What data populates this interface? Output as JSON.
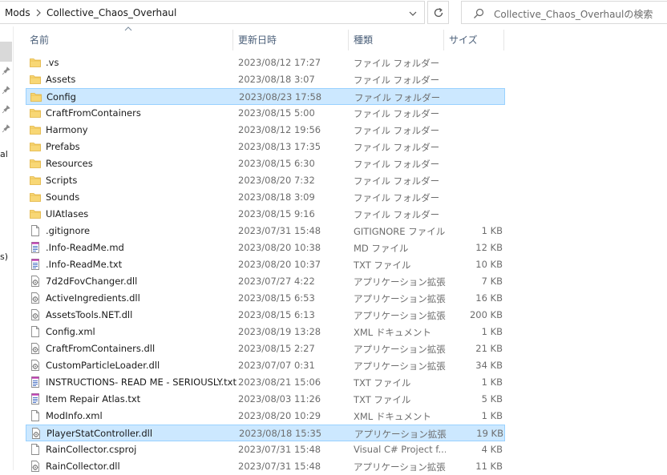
{
  "address": {
    "crumbs": [
      "Mods",
      "Collective_Chaos_Overhaul"
    ]
  },
  "search": {
    "placeholder": "Collective_Chaos_Overhaulの検索"
  },
  "nav": {
    "partial_labels": [
      "al",
      "s)"
    ]
  },
  "columns": {
    "name": "名前",
    "date": "更新日時",
    "type": "種類",
    "size": "サイズ"
  },
  "files": [
    {
      "name": ".vs",
      "date": "2023/08/12 17:27",
      "type": "ファイル フォルダー",
      "size": "",
      "icon": "folder-icon"
    },
    {
      "name": "Assets",
      "date": "2023/08/18 3:07",
      "type": "ファイル フォルダー",
      "size": "",
      "icon": "folder-icon"
    },
    {
      "name": "Config",
      "date": "2023/08/23 17:58",
      "type": "ファイル フォルダー",
      "size": "",
      "icon": "folder-icon"
    },
    {
      "name": "CraftFromContainers",
      "date": "2023/08/15 5:00",
      "type": "ファイル フォルダー",
      "size": "",
      "icon": "folder-icon"
    },
    {
      "name": "Harmony",
      "date": "2023/08/12 19:56",
      "type": "ファイル フォルダー",
      "size": "",
      "icon": "folder-icon"
    },
    {
      "name": "Prefabs",
      "date": "2023/08/13 17:35",
      "type": "ファイル フォルダー",
      "size": "",
      "icon": "folder-icon"
    },
    {
      "name": "Resources",
      "date": "2023/08/15 6:30",
      "type": "ファイル フォルダー",
      "size": "",
      "icon": "folder-icon"
    },
    {
      "name": "Scripts",
      "date": "2023/08/20 7:32",
      "type": "ファイル フォルダー",
      "size": "",
      "icon": "folder-icon"
    },
    {
      "name": "Sounds",
      "date": "2023/08/18 3:09",
      "type": "ファイル フォルダー",
      "size": "",
      "icon": "folder-icon"
    },
    {
      "name": "UIAtlases",
      "date": "2023/08/15 9:16",
      "type": "ファイル フォルダー",
      "size": "",
      "icon": "folder-icon"
    },
    {
      "name": ".gitignore",
      "date": "2023/07/31 15:48",
      "type": "GITIGNORE ファイル",
      "size": "1 KB",
      "icon": "file-icon"
    },
    {
      "name": ".Info-ReadMe.md",
      "date": "2023/08/20 10:38",
      "type": "MD ファイル",
      "size": "12 KB",
      "icon": "text-file-icon"
    },
    {
      "name": ".Info-ReadMe.txt",
      "date": "2023/08/20 10:37",
      "type": "TXT ファイル",
      "size": "10 KB",
      "icon": "text-file-icon"
    },
    {
      "name": "7d2dFovChanger.dll",
      "date": "2023/07/27 4:22",
      "type": "アプリケーション拡張",
      "size": "7 KB",
      "icon": "dll-file-icon"
    },
    {
      "name": "ActiveIngredients.dll",
      "date": "2023/08/15 6:53",
      "type": "アプリケーション拡張",
      "size": "16 KB",
      "icon": "dll-file-icon"
    },
    {
      "name": "AssetsTools.NET.dll",
      "date": "2023/08/15 6:13",
      "type": "アプリケーション拡張",
      "size": "200 KB",
      "icon": "dll-file-icon"
    },
    {
      "name": "Config.xml",
      "date": "2023/08/19 13:28",
      "type": "XML ドキュメント",
      "size": "1 KB",
      "icon": "file-icon"
    },
    {
      "name": "CraftFromContainers.dll",
      "date": "2023/08/15 2:27",
      "type": "アプリケーション拡張",
      "size": "21 KB",
      "icon": "dll-file-icon"
    },
    {
      "name": "CustomParticleLoader.dll",
      "date": "2023/07/07 0:31",
      "type": "アプリケーション拡張",
      "size": "34 KB",
      "icon": "dll-file-icon"
    },
    {
      "name": "INSTRUCTIONS- READ ME - SERIOUSLY.txt",
      "date": "2023/08/21 15:06",
      "type": "TXT ファイル",
      "size": "1 KB",
      "icon": "text-file-icon"
    },
    {
      "name": "Item Repair Atlas.txt",
      "date": "2023/08/03 11:26",
      "type": "TXT ファイル",
      "size": "5 KB",
      "icon": "text-file-icon"
    },
    {
      "name": "ModInfo.xml",
      "date": "2023/08/20 10:29",
      "type": "XML ドキュメント",
      "size": "1 KB",
      "icon": "file-icon"
    },
    {
      "name": "PlayerStatController.dll",
      "date": "2023/08/18 15:35",
      "type": "アプリケーション拡張",
      "size": "19 KB",
      "icon": "dll-file-icon"
    },
    {
      "name": "RainCollector.csproj",
      "date": "2023/07/31 15:48",
      "type": "Visual C# Project f...",
      "size": "4 KB",
      "icon": "file-icon"
    },
    {
      "name": "RainCollector.dll",
      "date": "2023/07/31 15:48",
      "type": "アプリケーション拡張",
      "size": "11 KB",
      "icon": "dll-file-icon"
    }
  ],
  "state": {
    "highlighted_rows": [
      2,
      22
    ]
  },
  "colors": {
    "selection_bg": "#cce8ff",
    "selection_border": "#99d1ff",
    "folder": "#f8d775",
    "header_text": "#4c607a"
  }
}
